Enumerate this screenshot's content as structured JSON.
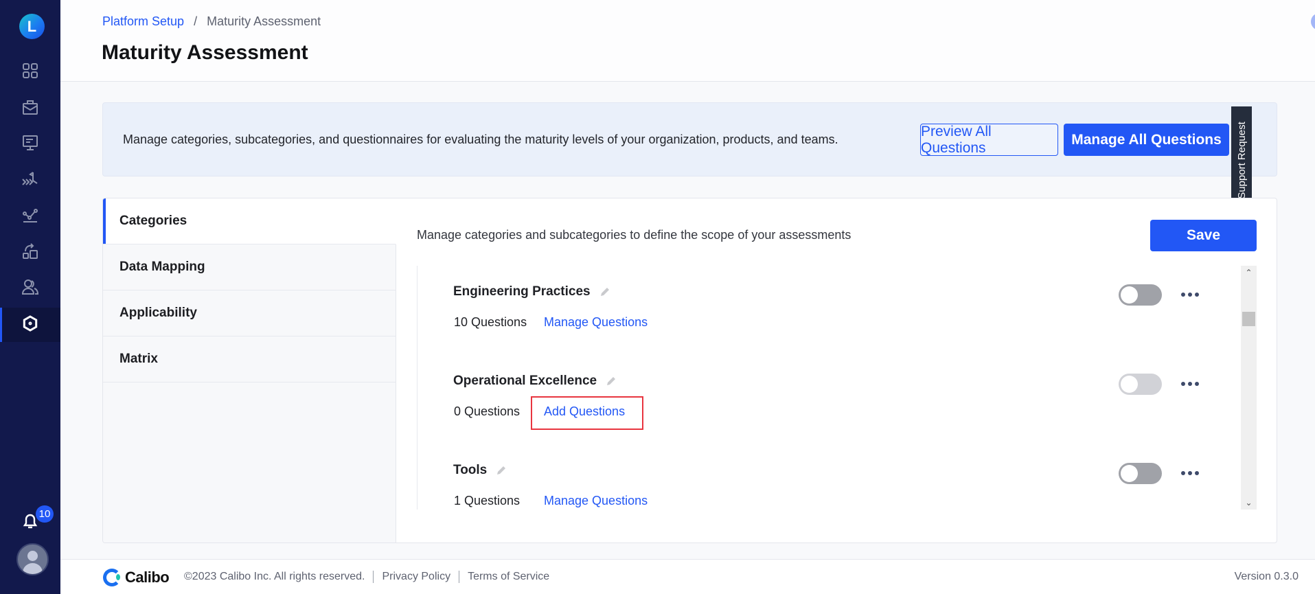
{
  "sidebar": {
    "logo_letter": "L",
    "nav_items": [
      {
        "name": "dashboard",
        "icon": "grid-icon"
      },
      {
        "name": "portfolio",
        "icon": "briefcase-icon"
      },
      {
        "name": "ideation",
        "icon": "presentation-icon"
      },
      {
        "name": "plan",
        "icon": "roadmap-icon"
      },
      {
        "name": "insights",
        "icon": "analytics-icon"
      },
      {
        "name": "orchestrate",
        "icon": "transform-icon"
      },
      {
        "name": "teams",
        "icon": "users-icon"
      },
      {
        "name": "platform-setup",
        "icon": "gear-icon",
        "active": true
      }
    ],
    "notification_count": "10"
  },
  "header": {
    "breadcrumb": [
      {
        "label": "Platform Setup",
        "link": true
      },
      {
        "label": "/",
        "link": false
      },
      {
        "label": "Maturity Assessment",
        "link": false
      }
    ],
    "title": "Maturity Assessment",
    "help_glyph": "?"
  },
  "banner": {
    "description": "Manage categories, subcategories, and questionnaires for evaluating the maturity levels of your organization, products, and teams.",
    "preview_button": "Preview All Questions",
    "manage_button": "Manage All Questions"
  },
  "support_tab": "Support Request",
  "tabs": [
    {
      "label": "Categories",
      "active": true
    },
    {
      "label": "Data Mapping",
      "active": false
    },
    {
      "label": "Applicability",
      "active": false
    },
    {
      "label": "Matrix",
      "active": false
    }
  ],
  "content": {
    "description": "Manage categories and subcategories to define the scope of your assessments",
    "save_button": "Save",
    "categories": [
      {
        "name": "Engineering Practices",
        "count": "10 Questions",
        "action": "Manage Questions",
        "enabled": false,
        "toggle_style": "dark"
      },
      {
        "name": "Operational Excellence",
        "count": "0 Questions",
        "action": "Add Questions",
        "enabled": false,
        "toggle_style": "light",
        "highlighted": true
      },
      {
        "name": "Tools",
        "count": "1 Questions",
        "action": "Manage Questions",
        "enabled": false,
        "toggle_style": "dark"
      }
    ]
  },
  "footer": {
    "brand": "Calibo",
    "copyright": "©2023 Calibo Inc. All rights reserved.",
    "privacy": "Privacy Policy",
    "terms": "Terms of Service",
    "version": "Version 0.3.0"
  },
  "colors": {
    "accent": "#2257f5",
    "sidebar_bg": "#12194c",
    "highlight": "#e8353f"
  }
}
